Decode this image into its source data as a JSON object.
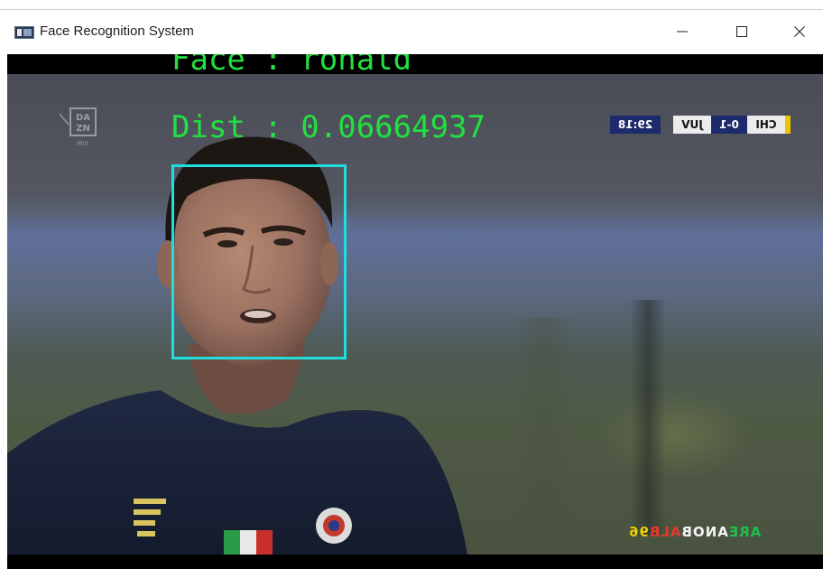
{
  "window": {
    "title": "Face Recognition System",
    "controls": {
      "minimize": "minimize",
      "maximize": "maximize",
      "close": "close"
    }
  },
  "video": {
    "detection": {
      "name_label": "Face : ronald",
      "distance_label": "Dist : 0.06664937",
      "box_color": "#20dede",
      "text_color": "#22e040"
    },
    "broadcast_logo": {
      "lines": [
        "DA",
        "ZN"
      ],
      "sub": "MIX"
    },
    "scoreboard": {
      "time": "29:18",
      "team_home": "JUV",
      "score": "0-1",
      "team_away": "CHI"
    },
    "watermark": {
      "part1": "96",
      "part2": "ALB",
      "part3": "ANOB",
      "part4": "ARE"
    }
  },
  "colors": {
    "accent": "#20dede",
    "text_overlay": "#22e040"
  }
}
